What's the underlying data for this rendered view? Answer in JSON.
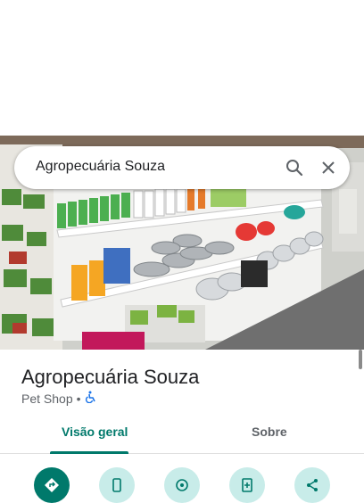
{
  "search": {
    "query": "Agropecuária Souza"
  },
  "place": {
    "name": "Agropecuária Souza",
    "category": "Pet Shop",
    "separator": "•"
  },
  "tabs": [
    {
      "label": "Visão geral",
      "selected": true
    },
    {
      "label": "Sobre",
      "selected": false
    }
  ],
  "actions": [
    {
      "icon": "directions-icon"
    },
    {
      "icon": "phone-icon"
    },
    {
      "icon": "location-icon"
    },
    {
      "icon": "add-to-list-icon"
    },
    {
      "icon": "share-icon"
    }
  ],
  "colors": {
    "accent": "#00796b",
    "action_bg": "#c8ece9"
  }
}
